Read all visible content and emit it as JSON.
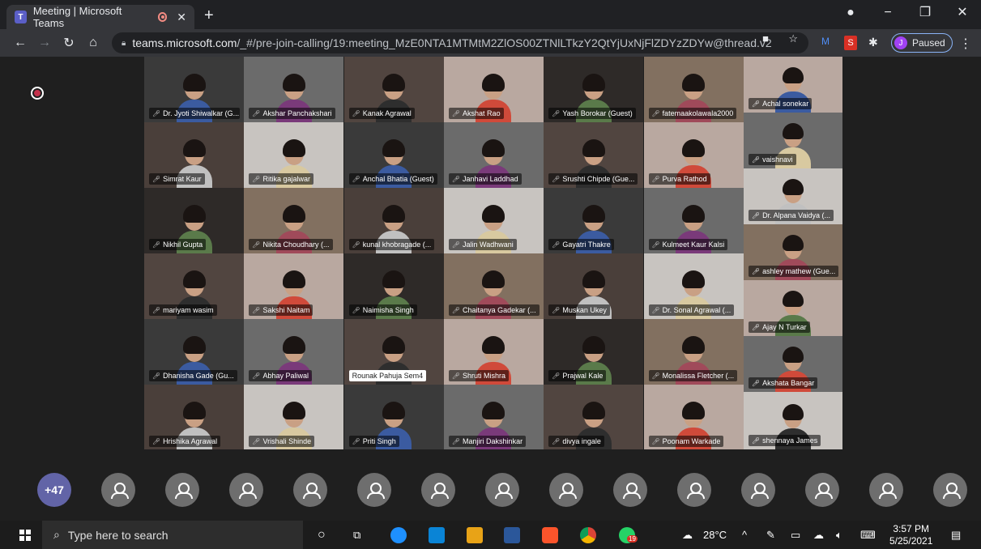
{
  "browser": {
    "tab_title": "Meeting | Microsoft Teams",
    "url_host": "teams.microsoft.com",
    "url_path": "/_#/pre-join-calling/19:meeting_MzE0NTA1MTMtM2ZlOS00ZTNlLTkzY2QtYjUxNjFlZDYzZDYw@thread.v2",
    "profile_initial": "J",
    "profile_status": "Paused"
  },
  "participants": [
    "Dr. Jyoti Shiwalkar (G...",
    "Akshar Panchakshari",
    "Kanak Agrawal",
    "Akshat Rao",
    "Yash Borokar (Guest)",
    "fatemaakolawala2000",
    "Simrat Kaur",
    "Ritika gajalwar",
    "Anchal Bhatia (Guest)",
    "Janhavi Laddhad",
    "Srushti Chipde (Gue...",
    "Purva Rathod",
    "Nikhil Gupta",
    "Nikita Choudhary (...",
    "kunal khobragade (...",
    "Jalin Wadhwani",
    "Gayatri Thakre",
    "Kulmeet Kaur Kalsi",
    "mariyam wasim",
    "Sakshi Naitam",
    "Naimisha Singh",
    "Chaitanya Gadekar (...",
    "Muskan Ukey",
    "Dr. Sonal Agrawal (...",
    "Dhanisha Gade (Gu...",
    "Abhay Paliwal",
    "Rounak Pahuja Sem4",
    "Shruti Mishra",
    "Prajwal Kale",
    "Monalissa Fletcher (...",
    "Hrishika Agrawal",
    "Vrishali Shinde",
    "Priti Singh",
    "Manjiri Dakshinkar",
    "divya ingale",
    "Poonam Warkade"
  ],
  "side_participants": [
    "Achal sonekar",
    "vaishnavi",
    "Dr. Alpana Vaidya (...",
    "ashley mathew (Gue...",
    "Ajay N Turkar",
    "Akshata Bangar",
    "shennaya James"
  ],
  "overflow_count": "+47",
  "taskbar": {
    "search_placeholder": "Type here to search",
    "weather": "28°C",
    "time": "3:57 PM",
    "date": "5/25/2021",
    "whatsapp_badge": "19",
    "notif_count": "1"
  },
  "colors": {
    "teams_purple": "#6264a7",
    "record_red": "#c4314b"
  }
}
